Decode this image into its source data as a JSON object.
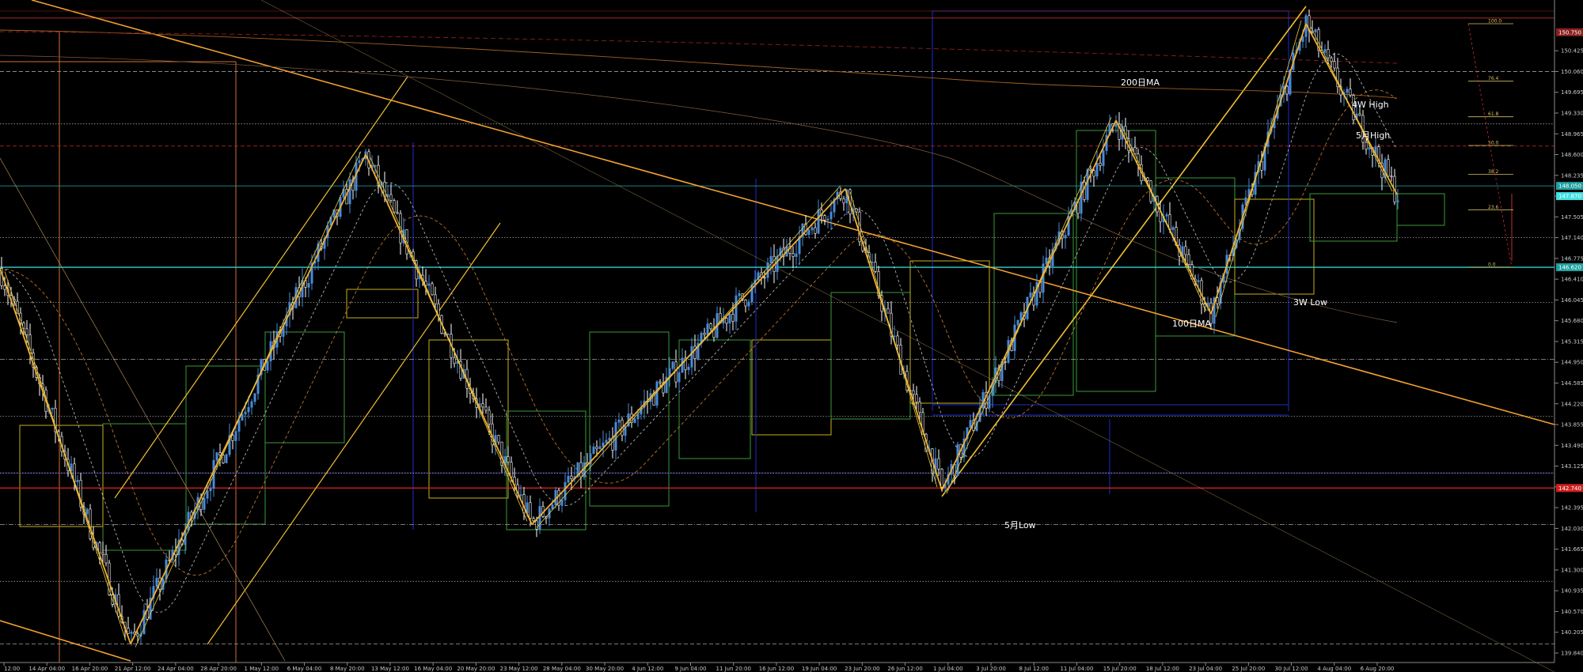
{
  "chart_data": {
    "type": "candlestick",
    "title": "",
    "xlabel": "",
    "ylabel": "",
    "ylim": [
      139.84,
      151.15
    ],
    "price_ticks": [
      "150.425",
      "150.060",
      "149.695",
      "149.330",
      "148.965",
      "148.600",
      "148.235",
      "147.870",
      "147.505",
      "147.140",
      "146.775",
      "146.410",
      "146.045",
      "145.680",
      "145.315",
      "144.950",
      "144.585",
      "144.220",
      "143.855",
      "143.490",
      "143.125",
      "142.760",
      "142.395",
      "142.030",
      "141.665",
      "141.300",
      "140.935",
      "140.570",
      "140.205",
      "139.840"
    ],
    "date_ticks": [
      "12:00",
      "14 Apr 04:00",
      "16 Apr 20:00",
      "21 Apr 12:00",
      "24 Apr 04:00",
      "28 Apr 20:00",
      "1 May 12:00",
      "6 May 04:00",
      "8 May 20:00",
      "13 May 12:00",
      "16 May 04:00",
      "20 May 20:00",
      "23 May 12:00",
      "28 May 04:00",
      "30 May 20:00",
      "4 Jun 12:00",
      "9 Jun 04:00",
      "11 Jun 20:00",
      "16 Jun 12:00",
      "19 Jun 04:00",
      "23 Jun 20:00",
      "26 Jun 12:00",
      "1 Jul 04:00",
      "3 Jul 20:00",
      "8 Jul 12:00",
      "11 Jul 04:00",
      "15 Jul 20:00",
      "18 Jul 12:00",
      "23 Jul 04:00",
      "25 Jul 20:00",
      "30 Jul 12:00",
      "4 Aug 04:00",
      "6 Aug 20:00"
    ],
    "current_price": "147.870",
    "highlight_price_tags": [
      {
        "price": "150.750",
        "color": "#8c2020"
      },
      {
        "price": "148.050",
        "color": "#20a0a0"
      },
      {
        "price": "147.870",
        "color": "#40e0e0"
      },
      {
        "price": "146.620",
        "color": "#20a0a0"
      },
      {
        "price": "142.740",
        "color": "#d02020"
      }
    ],
    "horizontal_levels": [
      {
        "price": 151.0,
        "color": "#c03030",
        "style": "solid"
      },
      {
        "price": 150.06,
        "color": "#a0a0a0",
        "style": "dashed"
      },
      {
        "price": 149.14,
        "color": "#a0a0a0",
        "style": "dotted"
      },
      {
        "price": 148.75,
        "color": "#c03030",
        "style": "dashed"
      },
      {
        "price": 148.05,
        "color": "#20b0b0",
        "style": "solid"
      },
      {
        "price": 147.14,
        "color": "#a0a0a0",
        "style": "dotted"
      },
      {
        "price": 146.62,
        "color": "#30d0d0",
        "style": "solid"
      },
      {
        "price": 146.0,
        "color": "#a0a0a0",
        "style": "dotted"
      },
      {
        "price": 145.0,
        "color": "#a0a0a0",
        "style": "dashdot"
      },
      {
        "price": 144.0,
        "color": "#a0a0a0",
        "style": "dotted"
      },
      {
        "price": 143.0,
        "color": "#a0a0a0",
        "style": "dotted"
      },
      {
        "price": 142.74,
        "color": "#d02020",
        "style": "solid"
      },
      {
        "price": 142.1,
        "color": "#a0a0a0",
        "style": "dashdot"
      },
      {
        "price": 141.1,
        "color": "#a0a0a0",
        "style": "dotted"
      },
      {
        "price": 140.0,
        "color": "#a0a0a0",
        "style": "dashed"
      }
    ],
    "swing_points": [
      {
        "date": "11 Apr",
        "price": 146.6
      },
      {
        "date": "22 Apr",
        "price": 140.0
      },
      {
        "date": "12 May",
        "price": 148.6
      },
      {
        "date": "27 May",
        "price": 142.1
      },
      {
        "date": "24 Jun",
        "price": 148.0
      },
      {
        "date": "3 Jul",
        "price": 142.7
      },
      {
        "date": "16 Jul",
        "price": 149.2
      },
      {
        "date": "25 Jul",
        "price": 145.8
      },
      {
        "date": "1 Aug",
        "price": 150.9
      },
      {
        "date": "8 Aug",
        "price": 147.9
      }
    ],
    "fib_levels": [
      "100.0",
      "76.4",
      "61.8",
      "50.0",
      "38.2",
      "23.6",
      "0.0"
    ],
    "annotations": [
      "200日MA",
      "4W High",
      "5月High",
      "3W Low",
      "100日MA",
      "5月Low"
    ]
  }
}
